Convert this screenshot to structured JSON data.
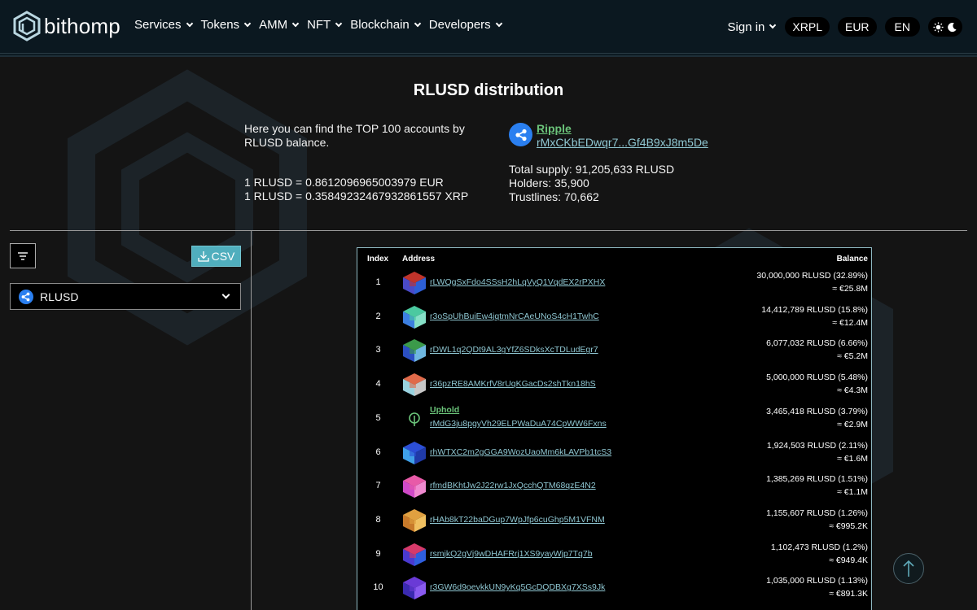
{
  "header": {
    "logo_text": "bithomp",
    "nav": [
      "Services",
      "Tokens",
      "AMM",
      "NFT",
      "Blockchain",
      "Developers"
    ],
    "signin": "Sign in",
    "network": "XRPL",
    "currency": "EUR",
    "language": "EN"
  },
  "page": {
    "title": "RLUSD distribution",
    "intro": "Here you can find the TOP 100 accounts by RLUSD balance.",
    "rate_eur": "1 RLUSD = 0.8612096965003979 EUR",
    "rate_xrp": "1 RLUSD = 0.35849232467932861557 XRP",
    "issuer_name": "Ripple",
    "issuer_address": "rMxCKbEDwqr7...Gf4B9xJ8m5De",
    "total_supply": "Total supply: 91,205,633 RLUSD",
    "holders": "Holders: 35,900",
    "trustlines": "Trustlines: 70,662"
  },
  "sidebar": {
    "csv_label": "CSV",
    "token_selected": "RLUSD"
  },
  "table": {
    "headers": {
      "index": "Index",
      "address": "Address",
      "balance": "Balance"
    },
    "rows": [
      {
        "index": "1",
        "address": "rLWQgSxFdo4SSsH2hLqVyQ1VqdEX2rPXHX",
        "balance": "30,000,000 RLUSD (32.89%)",
        "value": "≈ €25.8M",
        "colors": [
          "#c0342b",
          "#4a4ac8",
          "#2d5fd6"
        ]
      },
      {
        "index": "2",
        "address": "r3oSpUhBuiEw4jqtmNrCAeUNoS4cH1TwhC",
        "balance": "14,412,789 RLUSD (15.8%)",
        "value": "≈ €12.4M",
        "colors": [
          "#4bc9a0",
          "#3c7fe0",
          "#86e0c7"
        ]
      },
      {
        "index": "3",
        "address": "rDWL1q2QDt9AL3gYfZ6SDksXcTDLudEgr7",
        "balance": "6,077,032 RLUSD (6.66%)",
        "value": "≈ €5.2M",
        "colors": [
          "#3b9a4a",
          "#2b4fc2",
          "#6fb7e0"
        ]
      },
      {
        "index": "4",
        "address": "r36pzRE8AMKrfV8rUqKGacDs2shTkn18hS",
        "balance": "5,000,000 RLUSD (5.48%)",
        "value": "≈ €4.3M",
        "colors": [
          "#e06a4a",
          "#9ad3e0",
          "#c7c7c7"
        ]
      },
      {
        "index": "5",
        "username": "Uphold",
        "address": "rMdG3ju8pgyVh29ELPWaDuA74CpWW6Fxns",
        "balance": "3,465,418 RLUSD (3.79%)",
        "value": "≈ €2.9M",
        "colors": [
          "#000000",
          "#6bc47a",
          "#6bc47a"
        ]
      },
      {
        "index": "6",
        "address": "rhWTXC2m2gGGA9WozUaoMm6kLAVPb1tcS3",
        "balance": "1,924,503 RLUSD (2.11%)",
        "value": "≈ €1.6M",
        "colors": [
          "#2c4fd6",
          "#3fa0e8",
          "#1f3aa8"
        ]
      },
      {
        "index": "7",
        "address": "rfmdBKhtJw2J22rw1JxQcchQTM68qzE4N2",
        "balance": "1,385,269 RLUSD (1.51%)",
        "value": "≈ €1.1M",
        "colors": [
          "#e85aa8",
          "#d04ac8",
          "#f08ad0"
        ]
      },
      {
        "index": "8",
        "address": "rHAb8kT22baDGup7WpJfp6cuGhp5M1VFNM",
        "balance": "1,155,607 RLUSD (1.26%)",
        "value": "≈ €995.2K",
        "colors": [
          "#e0a040",
          "#c87a2a",
          "#f0c060"
        ]
      },
      {
        "index": "9",
        "address": "rsmjkQ2gVj9wDHAFRrj1XS9yayWjp7Tq7b",
        "balance": "1,102,473 RLUSD (1.2%)",
        "value": "≈ €949.4K",
        "colors": [
          "#d63a6a",
          "#4a3ad0",
          "#2f5fe0"
        ]
      },
      {
        "index": "10",
        "address": "r3GW6d9oevkkUN9yKq5GcDQDBXg7XSs9Jk",
        "balance": "1,035,000 RLUSD (1.13%)",
        "value": "≈ €891.3K",
        "colors": [
          "#6a3ad6",
          "#3a2ab0",
          "#8a5af0"
        ]
      }
    ]
  },
  "icons": {
    "logo": "bithomp-hex-logo-icon",
    "filter": "filter-icon",
    "download": "download-icon",
    "token": "xrp-ripple-icon",
    "theme": "sun-moon-icon",
    "scroll_top": "arrow-up-icon"
  }
}
